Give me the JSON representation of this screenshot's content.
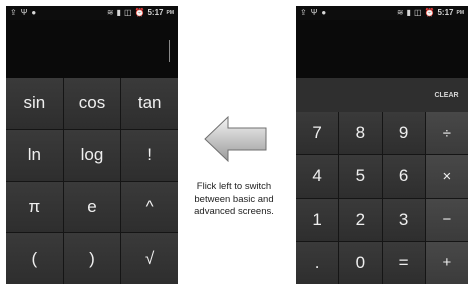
{
  "left_phone": {
    "status": {
      "left_icons": [
        "upload-icon",
        "usb-icon",
        "android-icon"
      ],
      "time": "5:17",
      "ampm": "PM"
    },
    "advanced_keys": [
      "sin",
      "cos",
      "tan",
      "ln",
      "log",
      "!",
      "π",
      "e",
      "^",
      "(",
      ")",
      "√"
    ]
  },
  "right_phone": {
    "status": {
      "time": "5:17",
      "ampm": "PM"
    },
    "clear_label": "CLEAR",
    "basic_keys": [
      "7",
      "8",
      "9",
      "÷",
      "4",
      "5",
      "6",
      "×",
      "1",
      "2",
      "3",
      "−",
      ".",
      "0",
      "=",
      "+"
    ]
  },
  "caption": [
    "Flick left to switch",
    "between basic and",
    "advanced screens."
  ],
  "colors": {
    "phone_bg": "#1a1a1a",
    "key_bg": "#333333",
    "op_key_bg": "#444444",
    "arrow_gray": "#9a9a9a"
  }
}
